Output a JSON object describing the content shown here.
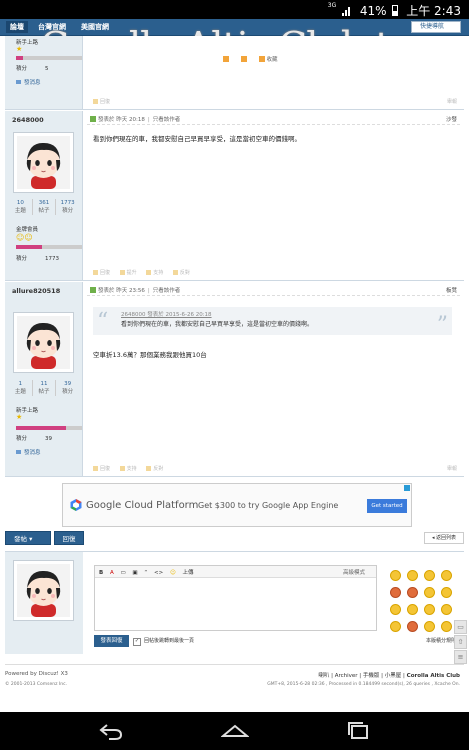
{
  "status": {
    "network": "3G",
    "battery": "41%",
    "time": "上午 2:43"
  },
  "nav": {
    "tabs": [
      "論壇",
      "台灣官網",
      "美國官網"
    ],
    "quick": "快捷導航"
  },
  "watermark": "Corolla-Altis-Club.tw",
  "post0": {
    "rank": "新手上路",
    "points_label": "積分",
    "points": "5",
    "sendmsg": "發消息",
    "tags": [
      "",
      "",
      "收藏"
    ],
    "actions": [
      "回復"
    ],
    "report": "舉報"
  },
  "post1": {
    "username": "2648000",
    "stats": [
      {
        "v": "10",
        "l": "主題"
      },
      {
        "v": "361",
        "l": "帖子"
      },
      {
        "v": "1773",
        "l": "積分"
      }
    ],
    "rank": "金牌會員",
    "points_label": "積分",
    "points": "1773",
    "meta_posted": "發表於 昨天 20:18",
    "meta_author": "只看該作者",
    "floor": "沙發",
    "content": "看到你們現在的車，我都安慰自己早買早享受，這是當初空車的價錢啊。",
    "actions": [
      "回復",
      "提升",
      "支持",
      "反對"
    ]
  },
  "post2": {
    "username": "allure820518",
    "stats": [
      {
        "v": "1",
        "l": "主題"
      },
      {
        "v": "11",
        "l": "帖子"
      },
      {
        "v": "39",
        "l": "積分"
      }
    ],
    "rank": "新手上路",
    "points_label": "積分",
    "points": "39",
    "sendmsg": "發消息",
    "meta_posted": "發表於 昨天 23:56",
    "meta_author": "只看該作者",
    "floor": "板凳",
    "quote_head": "2648000 發表於 2015-6-26 20:18",
    "quote_text": "看到你們現在的車，我都安慰自己早買早享受，這是當初空車的價錢啊。",
    "content": "空車折13.6萬？那個業務我跟他買10台",
    "actions": [
      "回復",
      "支持",
      "反對"
    ],
    "report": "舉報"
  },
  "ad": {
    "brand": "Google Cloud Platform",
    "headline": "Get $300 to try Google App Engine",
    "cta": "Get started"
  },
  "buttons": {
    "post": "發帖",
    "reply": "回復",
    "back": "◂ 返回列表"
  },
  "editor": {
    "tools": [
      "B",
      "A",
      "",
      "",
      "“",
      "<>",
      "",
      "上傳"
    ],
    "mode": "高級模式",
    "submit": "發表回復",
    "checkbox": "回帖後跳轉到最後一頁",
    "rules": "本版積分規則"
  },
  "footer": {
    "powered": "Powered by Discuz! X3",
    "copyright": "© 2001-2013 Comsenz Inc.",
    "links": [
      "喇叭",
      "Archiver",
      "手機版",
      "小黑屋"
    ],
    "site": "Corolla Altis Club",
    "gmt": "GMT+8, 2015-6-28 02:36 , Processed in 0.184499 second(s), 26 queries , Xcache On."
  }
}
